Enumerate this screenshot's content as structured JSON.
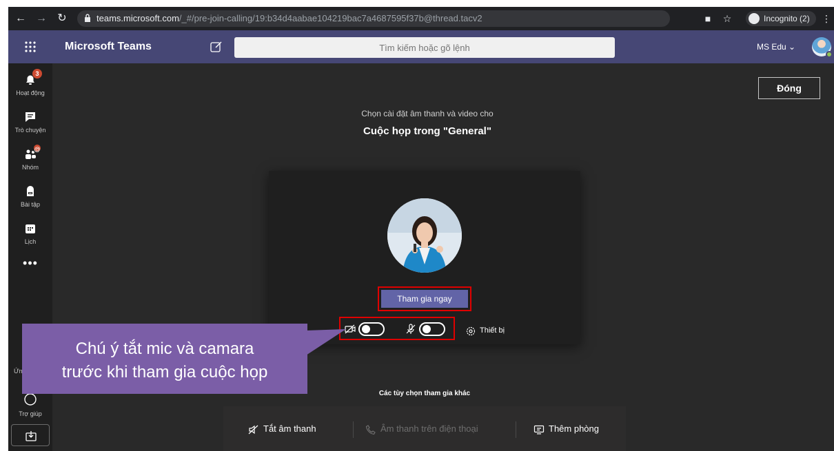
{
  "browser": {
    "url_host": "teams.microsoft.com",
    "url_path": "/_#/pre-join-calling/19:b34d4aabae104219bac7a4687595f37b@thread.tacv2",
    "incognito_label": "Incognito (2)"
  },
  "header": {
    "app_name": "Microsoft Teams",
    "search_placeholder": "Tìm kiếm hoặc gõ lệnh",
    "user_label": "MS Edu ⌄"
  },
  "rail": {
    "items": [
      {
        "label": "Hoạt động",
        "badge": "3"
      },
      {
        "label": "Trò chuyện"
      },
      {
        "label": "Nhóm",
        "badge": "@"
      },
      {
        "label": "Bài tập"
      },
      {
        "label": "Lịch"
      }
    ],
    "more": "•••",
    "apps_label": "Ứn",
    "help_label": "Trợ giúp"
  },
  "main": {
    "close_label": "Đóng",
    "subtitle": "Chọn cài đặt âm thanh và video cho",
    "title": "Cuộc họp trong \"General\"",
    "join_label": "Tham gia ngay",
    "device_label": "Thiết bị",
    "camera_on": false,
    "mic_on": false
  },
  "callout": {
    "line1": "Chú ý tắt mic và camara",
    "line2": "trước khi tham gia cuộc họp",
    "color": "#7b5ea7"
  },
  "other_options": {
    "heading": "Các tùy chọn tham gia khác",
    "mute_audio": "Tắt âm thanh",
    "phone_audio": "Âm thanh trên điện thoại",
    "add_room": "Thêm phòng"
  },
  "colors": {
    "header_bg": "#464775",
    "accent": "#6264a7",
    "highlight_border": "#e00000"
  }
}
